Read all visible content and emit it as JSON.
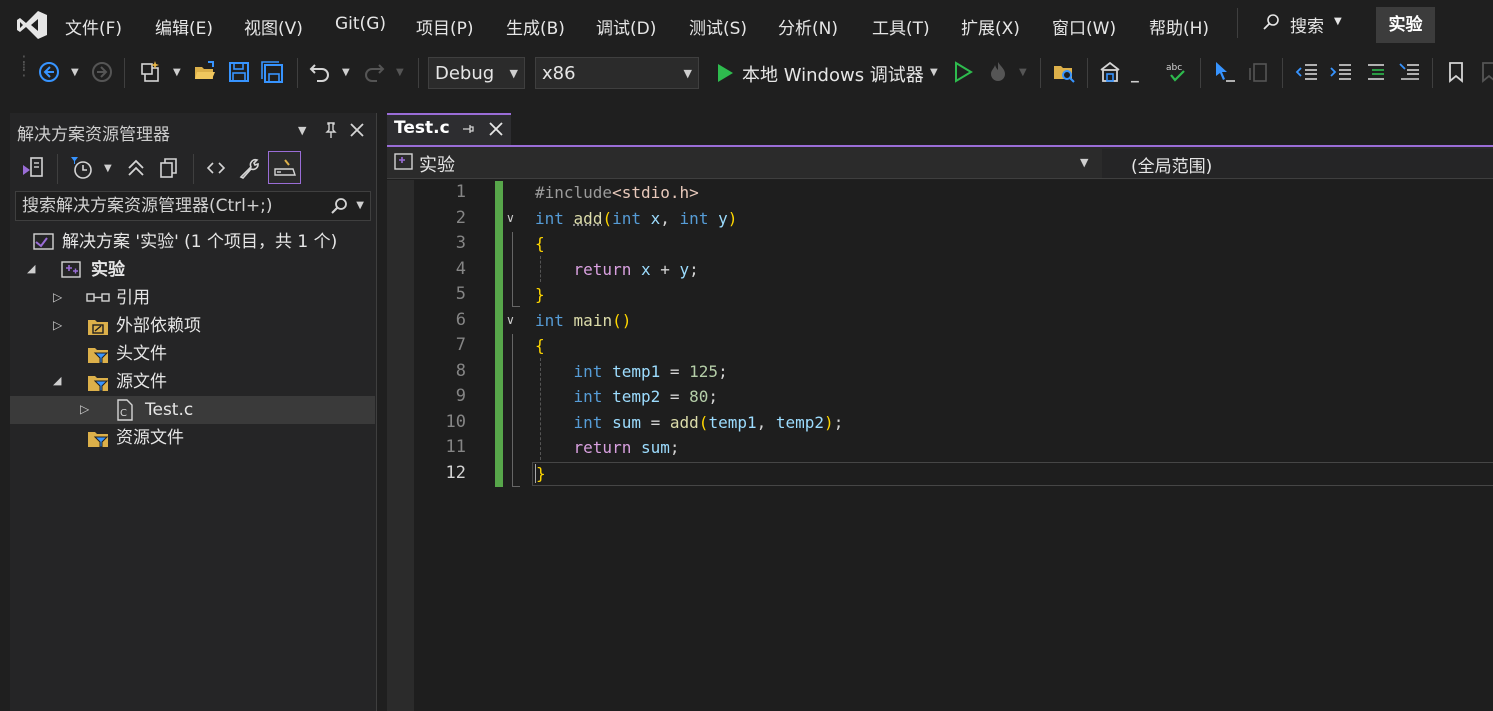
{
  "menu": [
    "文件(F)",
    "编辑(E)",
    "视图(V)",
    "Git(G)",
    "项目(P)",
    "生成(B)",
    "调试(D)",
    "测试(S)",
    "分析(N)",
    "工具(T)",
    "扩展(X)",
    "窗口(W)",
    "帮助(H)"
  ],
  "search_label": "搜索",
  "project_badge": "实验",
  "toolbar": {
    "config": "Debug",
    "platform": "x86",
    "run_label": "本地 Windows 调试器"
  },
  "solution_explorer": {
    "title": "解决方案资源管理器",
    "search_placeholder": "搜索解决方案资源管理器(Ctrl+;)",
    "tree": {
      "solution": "解决方案 '实验' (1 个项目，共 1 个)",
      "project": "实验",
      "references": "引用",
      "external_deps": "外部依赖项",
      "header_files": "头文件",
      "source_files": "源文件",
      "test_file": "Test.c",
      "resource_files": "资源文件"
    }
  },
  "editor": {
    "tab": "Test.c",
    "nav_project": "实验",
    "nav_scope": "(全局范围)",
    "line_numbers": [
      "1",
      "2",
      "3",
      "4",
      "5",
      "6",
      "7",
      "8",
      "9",
      "10",
      "11",
      "12"
    ],
    "code": {
      "l1_pp": "#include",
      "l1_inc": "<stdio.h>",
      "int": "int",
      "add": "add",
      "x": "x",
      "y": "y",
      "ret": "return",
      "main": "main",
      "temp1": "temp1",
      "temp2": "temp2",
      "sum": "sum",
      "v125": "125",
      "v80": "80"
    }
  },
  "colors": {
    "accent": "#9a6dd7",
    "change_bar": "#57a64a",
    "keyword": "#569cd6",
    "control": "#d8a0df",
    "function": "#dcdcaa",
    "variable": "#9cdcfe",
    "number": "#b5cea8"
  }
}
